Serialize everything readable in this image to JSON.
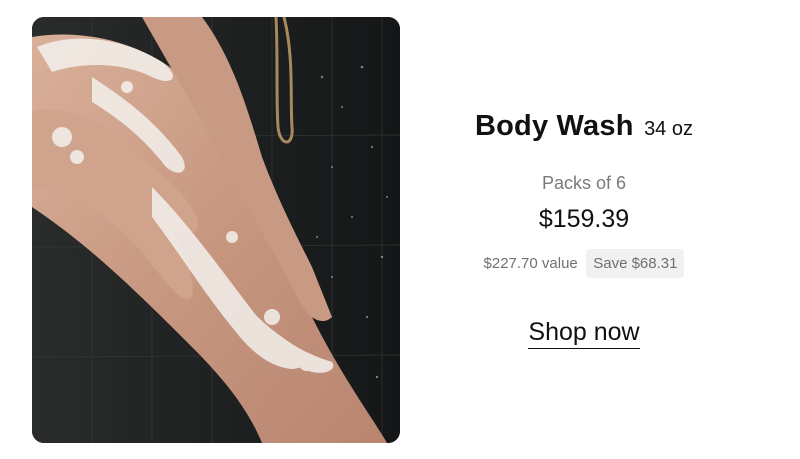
{
  "product": {
    "image_alt": "Person washing leg with foam in shower",
    "name": "Body Wash",
    "size": "34 oz",
    "pack_label": "Packs of 6",
    "price": "$159.39",
    "value_label": "$227.70 value",
    "save_label": "Save $68.31",
    "cta_label": "Shop now"
  },
  "colors": {
    "text_primary": "#111111",
    "text_muted": "#7a7a7a",
    "badge_bg": "#f1f1f1",
    "image_bg": "#1c1e1f"
  }
}
